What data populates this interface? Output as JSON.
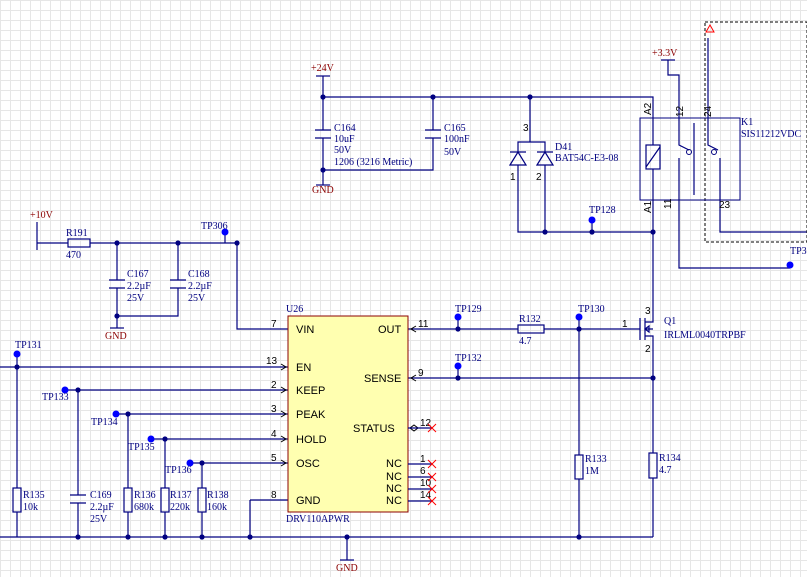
{
  "power": {
    "v24": "+24V",
    "v10": "+10V",
    "v33": "+3.3V",
    "gnd": "GND"
  },
  "testpoints": {
    "tp306": "TP306",
    "tp129": "TP129",
    "tp130": "TP130",
    "tp128": "TP128",
    "tp131": "TP131",
    "tp132": "TP132",
    "tp133": "TP133",
    "tp134": "TP134",
    "tp135": "TP135",
    "tp136": "TP136",
    "tp3": "TP3"
  },
  "caps": {
    "c164": {
      "ref": "C164",
      "l1": "10uF",
      "l2": "50V",
      "l3": "1206 (3216 Metric)"
    },
    "c165": {
      "ref": "C165",
      "l1": "100nF",
      "l2": "50V"
    },
    "c167": {
      "ref": "C167",
      "l1": "2.2µF",
      "l2": "25V"
    },
    "c168": {
      "ref": "C168",
      "l1": "2.2µF",
      "l2": "25V"
    },
    "c169": {
      "ref": "C169",
      "l1": "2.2µF",
      "l2": "25V"
    }
  },
  "resistors": {
    "r191": {
      "ref": "R191",
      "val": "470"
    },
    "r132": {
      "ref": "R132",
      "val": "4.7"
    },
    "r133": {
      "ref": "R133",
      "val": "1M"
    },
    "r134": {
      "ref": "R134",
      "val": "4.7"
    },
    "r135": {
      "ref": "R135",
      "val": "10k"
    },
    "r136": {
      "ref": "R136",
      "val": "680k"
    },
    "r137": {
      "ref": "R137",
      "val": "220k"
    },
    "r138": {
      "ref": "R138",
      "val": "160k"
    }
  },
  "ic": {
    "ref": "U26",
    "part": "DRV110APWR",
    "pins": {
      "vin": "VIN",
      "en": "EN",
      "keep": "KEEP",
      "peak": "PEAK",
      "hold": "HOLD",
      "osc": "OSC",
      "gnd": "GND",
      "out": "OUT",
      "sense": "SENSE",
      "status": "STATUS",
      "nc": "NC"
    },
    "nums": {
      "vin": "7",
      "en": "13",
      "keep": "2",
      "peak": "3",
      "hold": "4",
      "osc": "5",
      "gnd": "8",
      "out": "11",
      "sense": "9",
      "status": "12",
      "nc1": "1",
      "nc2": "6",
      "nc3": "10",
      "nc4": "14"
    }
  },
  "diode": {
    "ref": "D41",
    "part": "BAT54C-E3-08",
    "p1": "1",
    "p2": "2",
    "p3": "3"
  },
  "mosfet": {
    "ref": "Q1",
    "part": "IRLML0040TRPBF",
    "p1": "1",
    "p2": "2",
    "p3": "3"
  },
  "relay": {
    "ref": "K1",
    "part": "SIS11212VDC",
    "a2": "A2",
    "a1": "A1",
    "p12": "12",
    "p24": "24",
    "p11": "11",
    "p23": "23"
  }
}
